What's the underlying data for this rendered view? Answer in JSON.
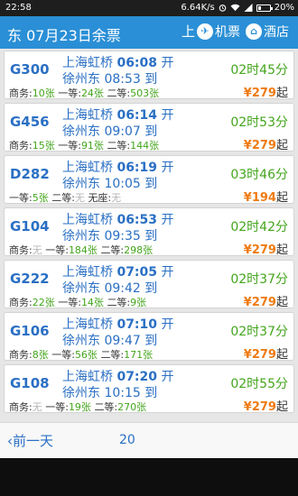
{
  "status": {
    "time": "22:58",
    "speed": "6.64K/s",
    "battery": "20%"
  },
  "header": {
    "title": "东 07月23日余票",
    "sep": "上",
    "flight_icon": "plane-icon",
    "flight_label": "机票",
    "hotel_icon": "hotel-icon",
    "hotel_label": "酒店"
  },
  "trains": [
    {
      "number": "G300",
      "from": "上海虹桥",
      "dep": "06:08",
      "dep_mark": "开",
      "to": "徐州东",
      "arr": "08:53",
      "arr_mark": "到",
      "duration": "02时45分",
      "seats": [
        {
          "label": "商务:",
          "value": "10张",
          "available": true
        },
        {
          "label": "一等:",
          "value": "24张",
          "available": true
        },
        {
          "label": "二等:",
          "value": "503张",
          "available": true
        }
      ],
      "currency": "¥",
      "price": "279",
      "price_suffix": "起"
    },
    {
      "number": "G456",
      "from": "上海虹桥",
      "dep": "06:14",
      "dep_mark": "开",
      "to": "徐州东",
      "arr": "09:07",
      "arr_mark": "到",
      "duration": "02时53分",
      "seats": [
        {
          "label": "商务:",
          "value": "15张",
          "available": true
        },
        {
          "label": "一等:",
          "value": "91张",
          "available": true
        },
        {
          "label": "二等:",
          "value": "144张",
          "available": true
        }
      ],
      "currency": "¥",
      "price": "279",
      "price_suffix": "起"
    },
    {
      "number": "D282",
      "from": "上海虹桥",
      "dep": "06:19",
      "dep_mark": "开",
      "to": "徐州东",
      "arr": "10:05",
      "arr_mark": "到",
      "duration": "03时46分",
      "seats": [
        {
          "label": "一等:",
          "value": "5张",
          "available": true
        },
        {
          "label": "二等:",
          "value": "无",
          "available": false
        },
        {
          "label": "无座:",
          "value": "无",
          "available": false
        }
      ],
      "currency": "¥",
      "price": "194",
      "price_suffix": "起"
    },
    {
      "number": "G104",
      "from": "上海虹桥",
      "dep": "06:53",
      "dep_mark": "开",
      "to": "徐州东",
      "arr": "09:35",
      "arr_mark": "到",
      "duration": "02时42分",
      "seats": [
        {
          "label": "商务:",
          "value": "无",
          "available": false
        },
        {
          "label": "一等:",
          "value": "184张",
          "available": true
        },
        {
          "label": "二等:",
          "value": "298张",
          "available": true
        }
      ],
      "currency": "¥",
      "price": "279",
      "price_suffix": "起"
    },
    {
      "number": "G222",
      "from": "上海虹桥",
      "dep": "07:05",
      "dep_mark": "开",
      "to": "徐州东",
      "arr": "09:42",
      "arr_mark": "到",
      "duration": "02时37分",
      "seats": [
        {
          "label": "商务:",
          "value": "22张",
          "available": true
        },
        {
          "label": "一等:",
          "value": "14张",
          "available": true
        },
        {
          "label": "二等:",
          "value": "9张",
          "available": true
        }
      ],
      "currency": "¥",
      "price": "279",
      "price_suffix": "起"
    },
    {
      "number": "G106",
      "from": "上海虹桥",
      "dep": "07:10",
      "dep_mark": "开",
      "to": "徐州东",
      "arr": "09:47",
      "arr_mark": "到",
      "duration": "02时37分",
      "seats": [
        {
          "label": "商务:",
          "value": "8张",
          "available": true
        },
        {
          "label": "一等:",
          "value": "56张",
          "available": true
        },
        {
          "label": "二等:",
          "value": "171张",
          "available": true
        }
      ],
      "currency": "¥",
      "price": "279",
      "price_suffix": "起"
    },
    {
      "number": "G108",
      "from": "上海虹桥",
      "dep": "07:20",
      "dep_mark": "开",
      "to": "徐州东",
      "arr": "10:15",
      "arr_mark": "到",
      "duration": "02时55分",
      "seats": [
        {
          "label": "商务:",
          "value": "无",
          "available": false
        },
        {
          "label": "一等:",
          "value": "19张",
          "available": true
        },
        {
          "label": "二等:",
          "value": "270张",
          "available": true
        }
      ],
      "currency": "¥",
      "price": "279",
      "price_suffix": "起"
    }
  ],
  "bottom": {
    "prev_icon": "chevron-left-icon",
    "prev_label": "前一天",
    "date_label": "20"
  },
  "colors": {
    "header_bg": "#2a8fd6",
    "train_blue": "#2a6fc4",
    "available_green": "#43a51c",
    "price_orange": "#ef7b13",
    "unavailable_gray": "#b5b5b5"
  }
}
